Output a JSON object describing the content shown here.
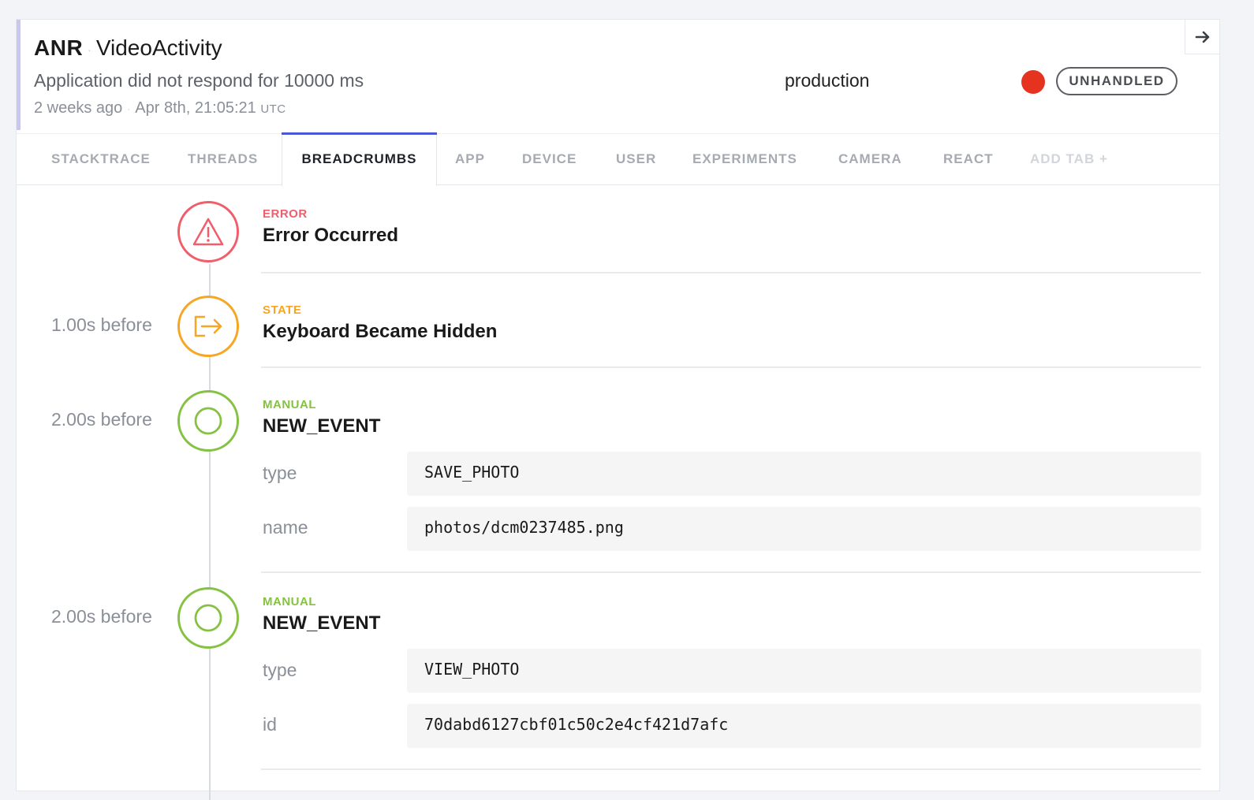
{
  "header": {
    "error_class": "ANR",
    "context": "VideoActivity",
    "message": "Application did not respond for 10000 ms",
    "relative_time": "2 weeks ago",
    "timestamp": "Apr 8th, 21:05:21",
    "timezone": "UTC",
    "environment": "production",
    "severity_color": "#e5331f",
    "handled_badge": "UNHANDLED"
  },
  "tabs": [
    {
      "label": "STACKTRACE"
    },
    {
      "label": "THREADS"
    },
    {
      "label": "BREADCRUMBS",
      "active": true
    },
    {
      "label": "APP"
    },
    {
      "label": "DEVICE"
    },
    {
      "label": "USER"
    },
    {
      "label": "EXPERIMENTS"
    },
    {
      "label": "CAMERA"
    },
    {
      "label": "REACT"
    },
    {
      "label": "ADD TAB +"
    }
  ],
  "colors": {
    "accent": "#4a57d6",
    "error": "#f05d6b",
    "state": "#f6a623",
    "manual": "#85c142"
  },
  "breadcrumbs": [
    {
      "time": "",
      "type": "ERROR",
      "name": "Error Occurred",
      "icon": "warning-triangle-icon",
      "meta": []
    },
    {
      "time": "1.00s before",
      "type": "STATE",
      "name": "Keyboard Became Hidden",
      "icon": "exit-icon",
      "meta": []
    },
    {
      "time": "2.00s before",
      "type": "MANUAL",
      "name": "NEW_EVENT",
      "icon": "circle-icon",
      "meta": [
        {
          "key": "type",
          "value": "SAVE_PHOTO"
        },
        {
          "key": "name",
          "value": "photos/dcm0237485.png"
        }
      ]
    },
    {
      "time": "2.00s before",
      "type": "MANUAL",
      "name": "NEW_EVENT",
      "icon": "circle-icon",
      "meta": [
        {
          "key": "type",
          "value": "VIEW_PHOTO"
        },
        {
          "key": "id",
          "value": "70dabd6127cbf01c50c2e4cf421d7afc"
        }
      ]
    }
  ]
}
